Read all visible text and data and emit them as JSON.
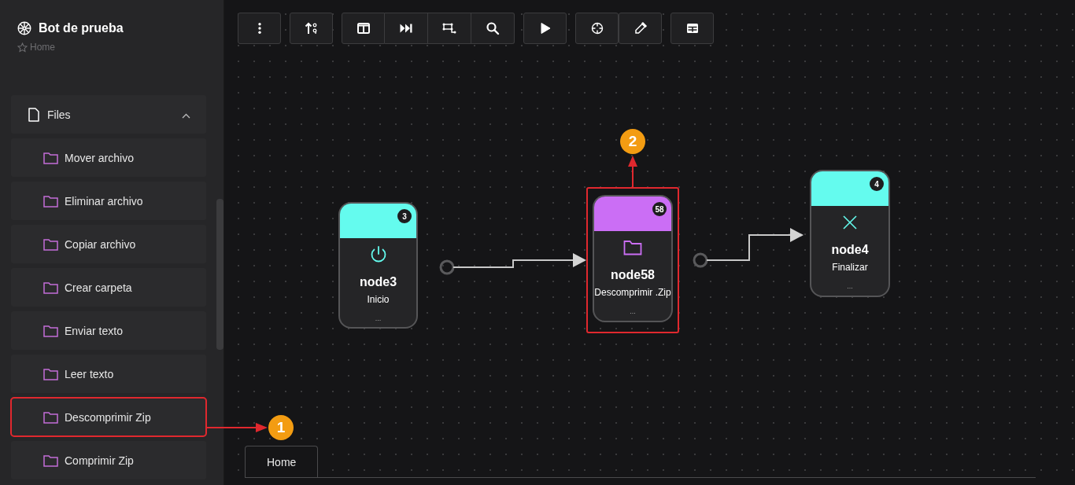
{
  "app": {
    "title": "Bot de prueba",
    "breadcrumb": "Home"
  },
  "sidebar": {
    "group": {
      "label": "Files",
      "expanded": true
    },
    "items": [
      {
        "label": "Mover archivo"
      },
      {
        "label": "Eliminar archivo"
      },
      {
        "label": "Copiar archivo"
      },
      {
        "label": "Crear carpeta"
      },
      {
        "label": "Enviar texto"
      },
      {
        "label": "Leer texto"
      },
      {
        "label": "Descomprimir Zip",
        "callout": "1"
      },
      {
        "label": "Comprimir Zip"
      }
    ]
  },
  "nodes": [
    {
      "kind": "start",
      "name": "node3",
      "subtitle": "Inicio",
      "badge": "3",
      "color": "#64fbee",
      "more": "..."
    },
    {
      "kind": "action",
      "name": "node58",
      "subtitle": "Descomprimir .Zip",
      "badge": "58",
      "color": "#cb6ef5",
      "more": "...",
      "callout": "2"
    },
    {
      "kind": "end",
      "name": "node4",
      "subtitle": "Finalizar",
      "badge": "4",
      "color": "#64fbee",
      "more": "..."
    }
  ],
  "tabs": [
    {
      "label": "Home",
      "selected": true
    }
  ]
}
